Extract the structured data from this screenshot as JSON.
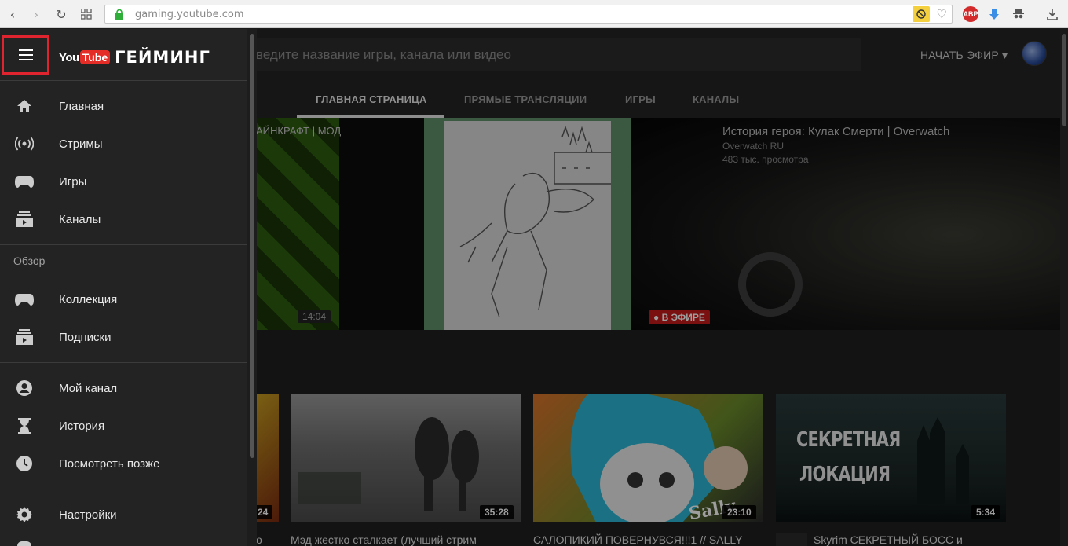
{
  "browser": {
    "url_host": "gaming.youtube.com",
    "ext_abp": "ABP"
  },
  "header": {
    "logo_you": "You",
    "logo_tube": "Tube",
    "logo_gaming": "ГЕЙМИНГ",
    "search_placeholder": "ведите название игры, канала или видео",
    "go_live": "НАЧАТЬ ЭФИР ▾"
  },
  "tabs": [
    {
      "label": "ГЛАВНАЯ СТРАНИЦА",
      "active": true
    },
    {
      "label": "ПРЯМЫЕ ТРАНСЛЯЦИИ",
      "active": false
    },
    {
      "label": "ИГРЫ",
      "active": false
    },
    {
      "label": "КАНАЛЫ",
      "active": false
    }
  ],
  "hero": {
    "left_title": "АЙНКРАФТ | МОД",
    "left_duration": "14:04",
    "right_title": "История героя: Кулак Смерти | Overwatch",
    "right_channel": "Overwatch RU",
    "right_views": "483 тыс. просмотра",
    "live_badge": "● В ЭФИРЕ"
  },
  "sidebar": {
    "items": [
      {
        "label": "Главная",
        "icon": "home-icon"
      },
      {
        "label": "Стримы",
        "icon": "live-icon"
      },
      {
        "label": "Игры",
        "icon": "gamepad-icon"
      },
      {
        "label": "Каналы",
        "icon": "channels-icon"
      }
    ],
    "section_title": "Обзор",
    "items2": [
      {
        "label": "Коллекция",
        "icon": "gamepad-icon"
      },
      {
        "label": "Подписки",
        "icon": "subscriptions-icon"
      }
    ],
    "items3": [
      {
        "label": "Мой канал",
        "icon": "account-icon"
      },
      {
        "label": "История",
        "icon": "hourglass-icon"
      },
      {
        "label": "Посмотреть позже",
        "icon": "clock-icon"
      }
    ],
    "items4": [
      {
        "label": "Настройки",
        "icon": "settings-icon"
      }
    ]
  },
  "cards": [
    {
      "title": "о",
      "duration": "24"
    },
    {
      "title": "Мэд жестко сталкает (лучший стрим",
      "duration": "35:28"
    },
    {
      "title": "САЛОПИКИЙ ПОВЕРНУВСЯ!!!1 // SALLY",
      "duration": "23:10",
      "thumb_text": "Sally"
    },
    {
      "title": "Skyrim СЕКРЕТНЫЙ БОСС и",
      "duration": "5:34",
      "thumb_text_1": "СЕКРЕТНАЯ",
      "thumb_text_2": "ЛОКАЦИЯ"
    }
  ],
  "colors": {
    "accent_red": "#e52d27",
    "menu_highlight": "#e0242f",
    "live_red": "#c61a1a"
  }
}
